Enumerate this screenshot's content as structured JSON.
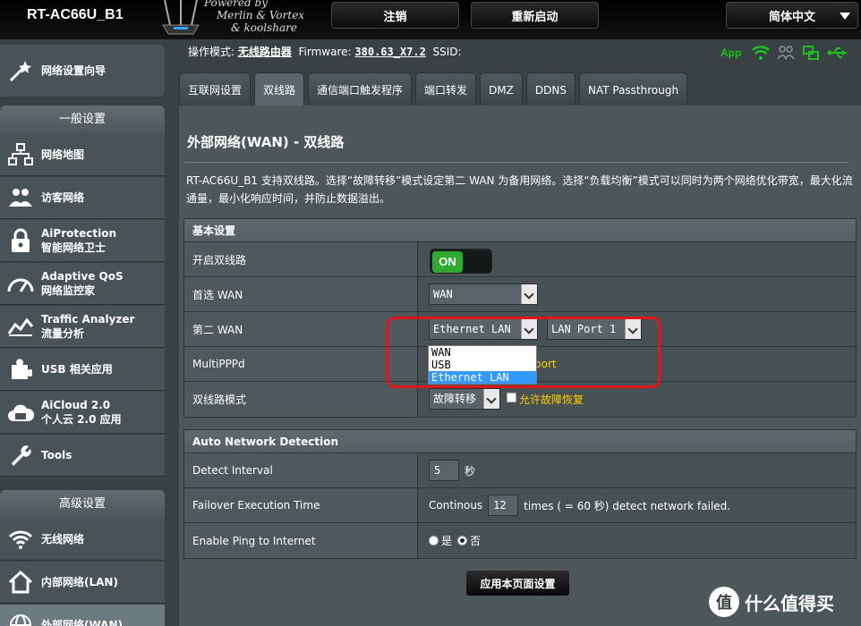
{
  "header": {
    "model": "RT-AC66U_B1",
    "credit": [
      "Powered by",
      "Merlin & Vortex",
      "& koolshare"
    ],
    "logout_label": "注销",
    "reboot_label": "重新启动",
    "language_label": "简体中文"
  },
  "status": {
    "mode_label": "操作模式:",
    "mode_value": "无线路由器",
    "firmware_label": "Firmware:",
    "firmware_value": "380.63_X7.2",
    "ssid_label": "SSID:",
    "app_label": "App"
  },
  "sidebar": {
    "wizard": "网络设置向导",
    "general_header": "一般设置",
    "general_items": [
      {
        "line1": "网络地图",
        "line2": ""
      },
      {
        "line1": "访客网络",
        "line2": ""
      },
      {
        "line1": "AiProtection",
        "line2": "智能网络卫士"
      },
      {
        "line1": "Adaptive QoS",
        "line2": "网络监控家"
      },
      {
        "line1": "Traffic Analyzer",
        "line2": "流量分析"
      },
      {
        "line1": "USB 相关应用",
        "line2": ""
      },
      {
        "line1": "AiCloud 2.0",
        "line2": "个人云 2.0 应用"
      },
      {
        "line1": "Tools",
        "line2": ""
      }
    ],
    "advanced_header": "高级设置",
    "advanced_items": [
      {
        "line1": "无线网络",
        "line2": ""
      },
      {
        "line1": "内部网络(LAN)",
        "line2": ""
      },
      {
        "line1": "外部网络(WAN)",
        "line2": ""
      }
    ]
  },
  "tabs": [
    "互联网设置",
    "双线路",
    "通信端口触发程序",
    "端口转发",
    "DMZ",
    "DDNS",
    "NAT Passthrough"
  ],
  "page": {
    "title": "外部网络(WAN) - 双线路",
    "description": "RT-AC66U_B1 支持双线路。选择“故障转移”模式设定第二 WAN 为备用网络。选择“负载均衡”模式可以同时为两个网络优化带宽，最大化流通量，最小化响应时间，并防止数据溢出。"
  },
  "basic": {
    "header": "基本设置",
    "enable_label": "开启双线路",
    "enable_value": "ON",
    "primary_label": "首选 WAN",
    "primary_value": "WAN",
    "secondary_label": "第二 WAN",
    "secondary_value": "Ethernet LAN",
    "secondary_port": "LAN Port 1",
    "secondary_options": [
      "WAN",
      "USB",
      "Ethernet LAN"
    ],
    "multipppd_label": "MultiPPPd",
    "multipppd_partial": "port",
    "mode_label": "双线路模式",
    "mode_value": "故障转移",
    "allow_failback": "允许故障恢复"
  },
  "detection": {
    "header": "Auto Network Detection",
    "interval_label": "Detect Interval",
    "interval_value": "5",
    "interval_unit": "秒",
    "failover_label": "Failover Execution Time",
    "failover_prefix": "Continous",
    "failover_value": "12",
    "failover_suffix": "times ( = 60  秒) detect network failed.",
    "ping_label": "Enable Ping to Internet",
    "ping_yes": "是",
    "ping_no": "否"
  },
  "apply_label": "应用本页面设置",
  "watermark": {
    "icon_text": "值",
    "text": "什么值得买"
  },
  "colors": {
    "accent_green": "#19c319",
    "highlight_red": "#e2141b",
    "selection_blue": "#3399ff",
    "warning_yellow": "#ffcc00"
  }
}
